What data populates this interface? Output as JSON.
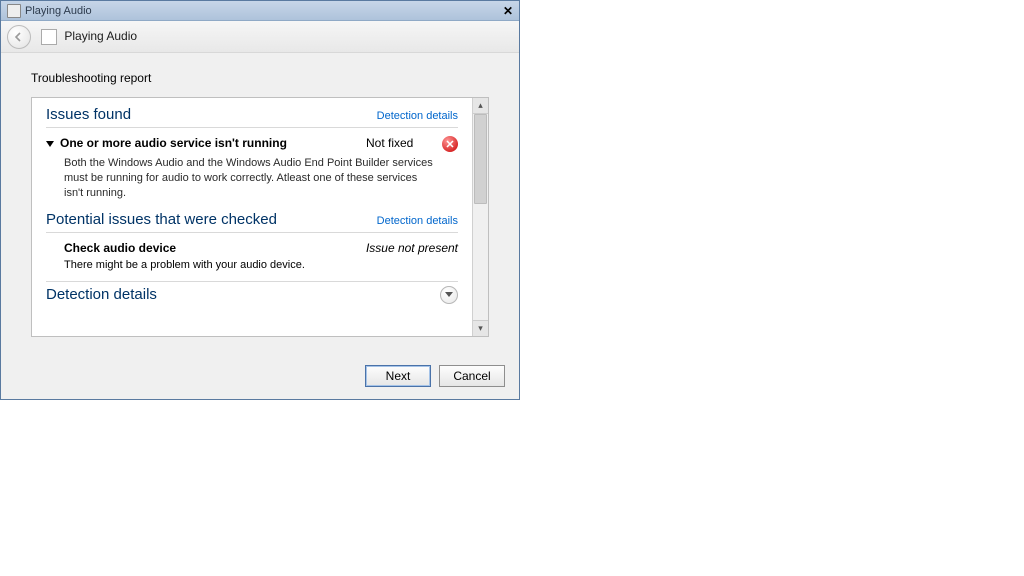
{
  "window": {
    "title": "Playing Audio",
    "breadcrumb": "Playing Audio"
  },
  "report": {
    "label": "Troubleshooting report",
    "sections": {
      "issues": {
        "heading": "Issues found",
        "link": "Detection details",
        "item": {
          "title": "One or more audio service isn't running",
          "status": "Not fixed",
          "description": "Both the Windows Audio and the Windows Audio End Point Builder services must be running for audio to work correctly. Atleast one of these services isn't running."
        }
      },
      "potential": {
        "heading": "Potential issues that were checked",
        "link": "Detection details",
        "item": {
          "title": "Check audio device",
          "status": "Issue not present",
          "description": "There might be a problem with your audio device."
        }
      },
      "details": {
        "heading": "Detection details"
      }
    }
  },
  "buttons": {
    "next": "Next",
    "cancel": "Cancel"
  }
}
